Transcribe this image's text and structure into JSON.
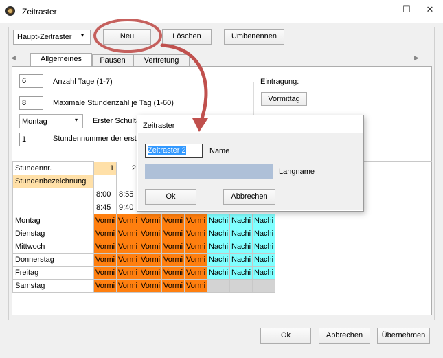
{
  "window": {
    "title": "Zeitraster",
    "minimize": "—",
    "maximize": "☐",
    "close": "✕"
  },
  "toolbar": {
    "combo_value": "Haupt-Zeitraster",
    "new": "Neu",
    "delete": "Löschen",
    "rename": "Umbenennen"
  },
  "tabs": [
    "Allgemeines",
    "Pausen",
    "Vertretung"
  ],
  "general": {
    "days_value": "6",
    "days_label": "Anzahl Tage (1-7)",
    "max_hours_value": "8",
    "max_hours_label": "Maximale Stundenzahl je Tag (1-60)",
    "first_day_value": "Montag",
    "first_day_label": "Erster Schultag",
    "hour_number_value": "1",
    "hour_number_label": "Stundennummer der ersten Stunde",
    "entry_label": "Eintragung:",
    "entry_button": "Vormittag"
  },
  "grid": {
    "header_label": "Stundennr.",
    "desc_label": "Stundenbezeichnung",
    "col_numbers": [
      "1",
      "2"
    ],
    "start_times": [
      "8:00",
      "8:55"
    ],
    "end_times": [
      "8:45",
      "9:40"
    ],
    "days": [
      "Montag",
      "Dienstag",
      "Mittwoch",
      "Donnerstag",
      "Freitag",
      "Samstag"
    ],
    "cell_morning": "Vormi",
    "cell_afternoon": "Nachi",
    "pattern": [
      [
        "m",
        "m",
        "m",
        "m",
        "m",
        "a",
        "a",
        "a"
      ],
      [
        "m",
        "m",
        "m",
        "m",
        "m",
        "a",
        "a",
        "a"
      ],
      [
        "m",
        "m",
        "m",
        "m",
        "m",
        "a",
        "a",
        "a"
      ],
      [
        "m",
        "m",
        "m",
        "m",
        "m",
        "a",
        "a",
        "a"
      ],
      [
        "m",
        "m",
        "m",
        "m",
        "m",
        "a",
        "a",
        "a"
      ],
      [
        "m",
        "m",
        "m",
        "m",
        "m",
        "e",
        "e",
        "e"
      ]
    ],
    "colors": {
      "morning": "#ff7f0f",
      "afternoon": "#80ffff",
      "empty": "#d3d3d3",
      "header_highlight": "#ffe0a8"
    }
  },
  "dialog": {
    "title": "Zeitraster",
    "name_value": "Zeitraster 2",
    "name_label": "Name",
    "longname_value": "",
    "longname_label": "Langname",
    "ok": "Ok",
    "cancel": "Abbrechen"
  },
  "footer": {
    "ok": "Ok",
    "cancel": "Abbrechen",
    "apply": "Übernehmen"
  },
  "annotation": {
    "color": "#c0504d"
  }
}
